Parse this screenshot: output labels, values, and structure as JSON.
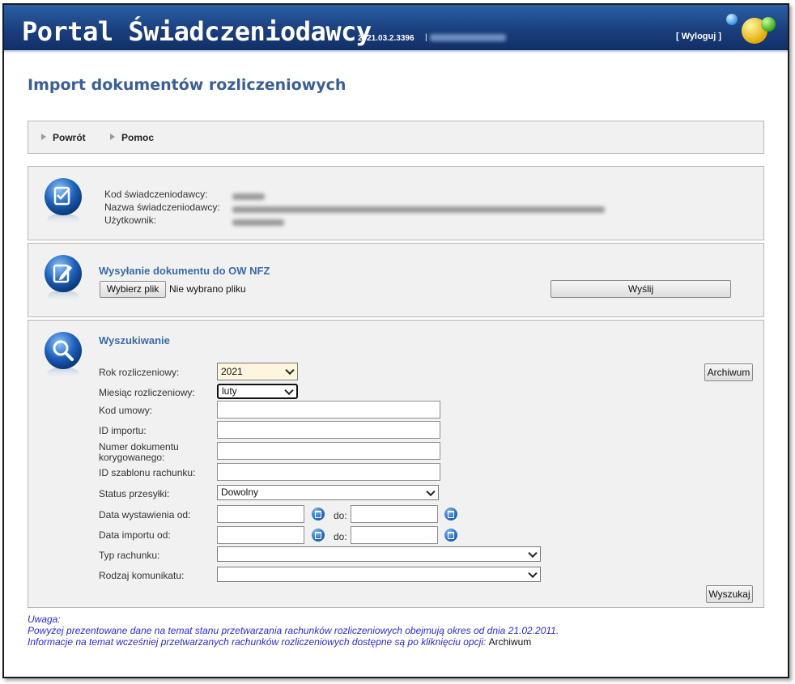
{
  "header": {
    "title": "Portal Świadczeniodawcy",
    "version": "2021.03.2.3396",
    "separator": "|",
    "logout": "[ Wyloguj ]"
  },
  "page": {
    "title": "Import dokumentów rozliczeniowych"
  },
  "toolbar": {
    "back": "Powrót",
    "help": "Pomoc"
  },
  "info": {
    "labels": [
      "Kod świadczeniodawcy:",
      "Nazwa świadczeniodawcy:",
      "Użytkownik:"
    ]
  },
  "send": {
    "title": "Wysyłanie dokumentu do OW NFZ",
    "choose_file": "Wybierz plik",
    "no_file": "Nie wybrano pliku",
    "submit": "Wyślij"
  },
  "search": {
    "title": "Wyszukiwanie",
    "archive_button": "Archiwum",
    "year_label": "Rok rozliczeniowy:",
    "year_value": "2021",
    "month_label": "Miesiąc rozliczeniowy:",
    "month_value": "luty",
    "contract_label": "Kod umowy:",
    "import_id_label": "ID importu:",
    "corrected_doc_label_1": "Numer dokumentu",
    "corrected_doc_label_2": "korygowanego:",
    "template_id_label": "ID szablonu rachunku:",
    "status_label": "Status przesyłki:",
    "status_value": "Dowolny",
    "issue_date_label": "Data wystawienia od:",
    "import_date_label": "Data importu od:",
    "to_label": "do:",
    "bill_type_label": "Typ rachunku:",
    "message_type_label": "Rodzaj komunikatu:",
    "search_button": "Wyszukaj"
  },
  "notes": {
    "line1": "Uwaga:",
    "line2": "Powyżej prezentowane dane na temat stanu przetwarzania rachunków rozliczeniowych obejmują okres od dnia 21.02.2011.",
    "line3": "Informacje na temat wcześniej przetwarzanych rachunków rozliczeniowych dostępne są po kliknięciu opcji:",
    "link": "Archiwum"
  },
  "icons": {
    "header_balls": "decorative-balls-icon",
    "info": "checklist-icon",
    "send": "edit-document-icon",
    "search": "magnifier-icon",
    "calendar": "calendar-icon"
  },
  "colors": {
    "header_bg": "#1b3f7e",
    "section_title": "#3a6aa8",
    "page_title": "#3a5f97",
    "notes": "#2a2adf"
  }
}
